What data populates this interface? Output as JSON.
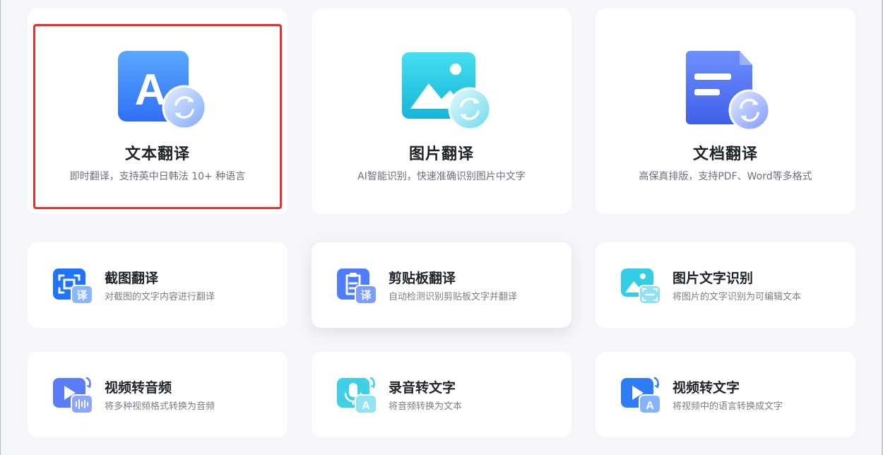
{
  "features_top": [
    {
      "title": "文本翻译",
      "description": "即时翻译，支持英中日韩法 10+ 种语言",
      "icon": "text-translate-icon"
    },
    {
      "title": "图片翻译",
      "description": "AI智能识别，快速准确识别图片中文字",
      "icon": "image-translate-icon"
    },
    {
      "title": "文档翻译",
      "description": "高保真排版，支持PDF、Word等多格式",
      "icon": "document-translate-icon"
    }
  ],
  "features_tools": [
    {
      "title": "截图翻译",
      "description": "对截图的文字内容进行翻译",
      "icon": "screenshot-translate-icon",
      "badge": "译"
    },
    {
      "title": "剪贴板翻译",
      "description": "自动检测识别剪贴板文字并翻译",
      "icon": "clipboard-translate-icon",
      "badge": "译"
    },
    {
      "title": "图片文字识别",
      "description": "将图片的文字识别为可编辑文本",
      "icon": "image-ocr-icon"
    },
    {
      "title": "视频转音频",
      "description": "将多种视频格式转换为音频",
      "icon": "video-to-audio-icon"
    },
    {
      "title": "录音转文字",
      "description": "将音频转换为文本",
      "icon": "audio-to-text-icon",
      "badge": "A"
    },
    {
      "title": "视频转文字",
      "description": "将视频中的语言转换成文字",
      "icon": "video-to-text-icon",
      "badge": "A"
    }
  ],
  "glyphs": {
    "text_letter": "A"
  },
  "colors": {
    "selection_outline": "#e8302a",
    "accent_blue": "#3d7bff",
    "accent_cyan": "#28c6e6",
    "card_bg": "#ffffff",
    "page_bg": "#f5f6f9"
  }
}
